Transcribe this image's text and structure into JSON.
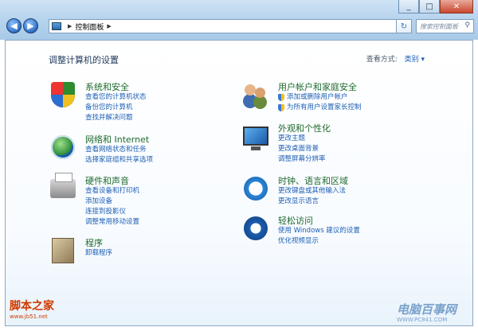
{
  "window": {
    "minimize_glyph": "_",
    "maximize_glyph": "□",
    "close_glyph": "✕"
  },
  "nav": {
    "back_glyph": "◀",
    "forward_glyph": "▶",
    "breadcrumb": "控制面板",
    "refresh_glyph": "↻",
    "search_placeholder": "搜索控制面板"
  },
  "header": {
    "title": "调整计算机的设置",
    "view_by_label": "查看方式:",
    "view_by_value": "类别 ▾"
  },
  "categories": [
    {
      "title": "系统和安全",
      "icon": "security-shield-icon",
      "links": [
        "查看您的计算机状态",
        "备份您的计算机",
        "查找并解决问题"
      ]
    },
    {
      "title": "网络和 Internet",
      "icon": "network-globe-icon",
      "links": [
        "查看网络状态和任务",
        "选择家庭组和共享选项"
      ]
    },
    {
      "title": "硬件和声音",
      "icon": "printer-icon",
      "links": [
        "查看设备和打印机",
        "添加设备",
        "连接到投影仪",
        "调整常用移动设置"
      ]
    },
    {
      "title": "程序",
      "icon": "programs-box-icon",
      "links": [
        "卸载程序"
      ]
    },
    {
      "title": "用户帐户和家庭安全",
      "icon": "users-icon",
      "links": [
        "添加或删除用户帐户",
        "为所有用户设置家长控制"
      ]
    },
    {
      "title": "外观和个性化",
      "icon": "monitor-icon",
      "links": [
        "更改主题",
        "更改桌面背景",
        "调整屏幕分辨率"
      ]
    },
    {
      "title": "时钟、语言和区域",
      "icon": "clock-globe-icon",
      "links": [
        "更改键盘或其他输入法",
        "更改显示语言"
      ]
    },
    {
      "title": "轻松访问",
      "icon": "ease-of-access-icon",
      "links": [
        "使用 Windows 建议的设置",
        "优化视频显示"
      ]
    }
  ],
  "watermarks": {
    "left_title": "脚本之家",
    "left_url": "www.jb51.net",
    "right_title": "电脑百事网",
    "right_url": "WWW.PC841.COM"
  }
}
